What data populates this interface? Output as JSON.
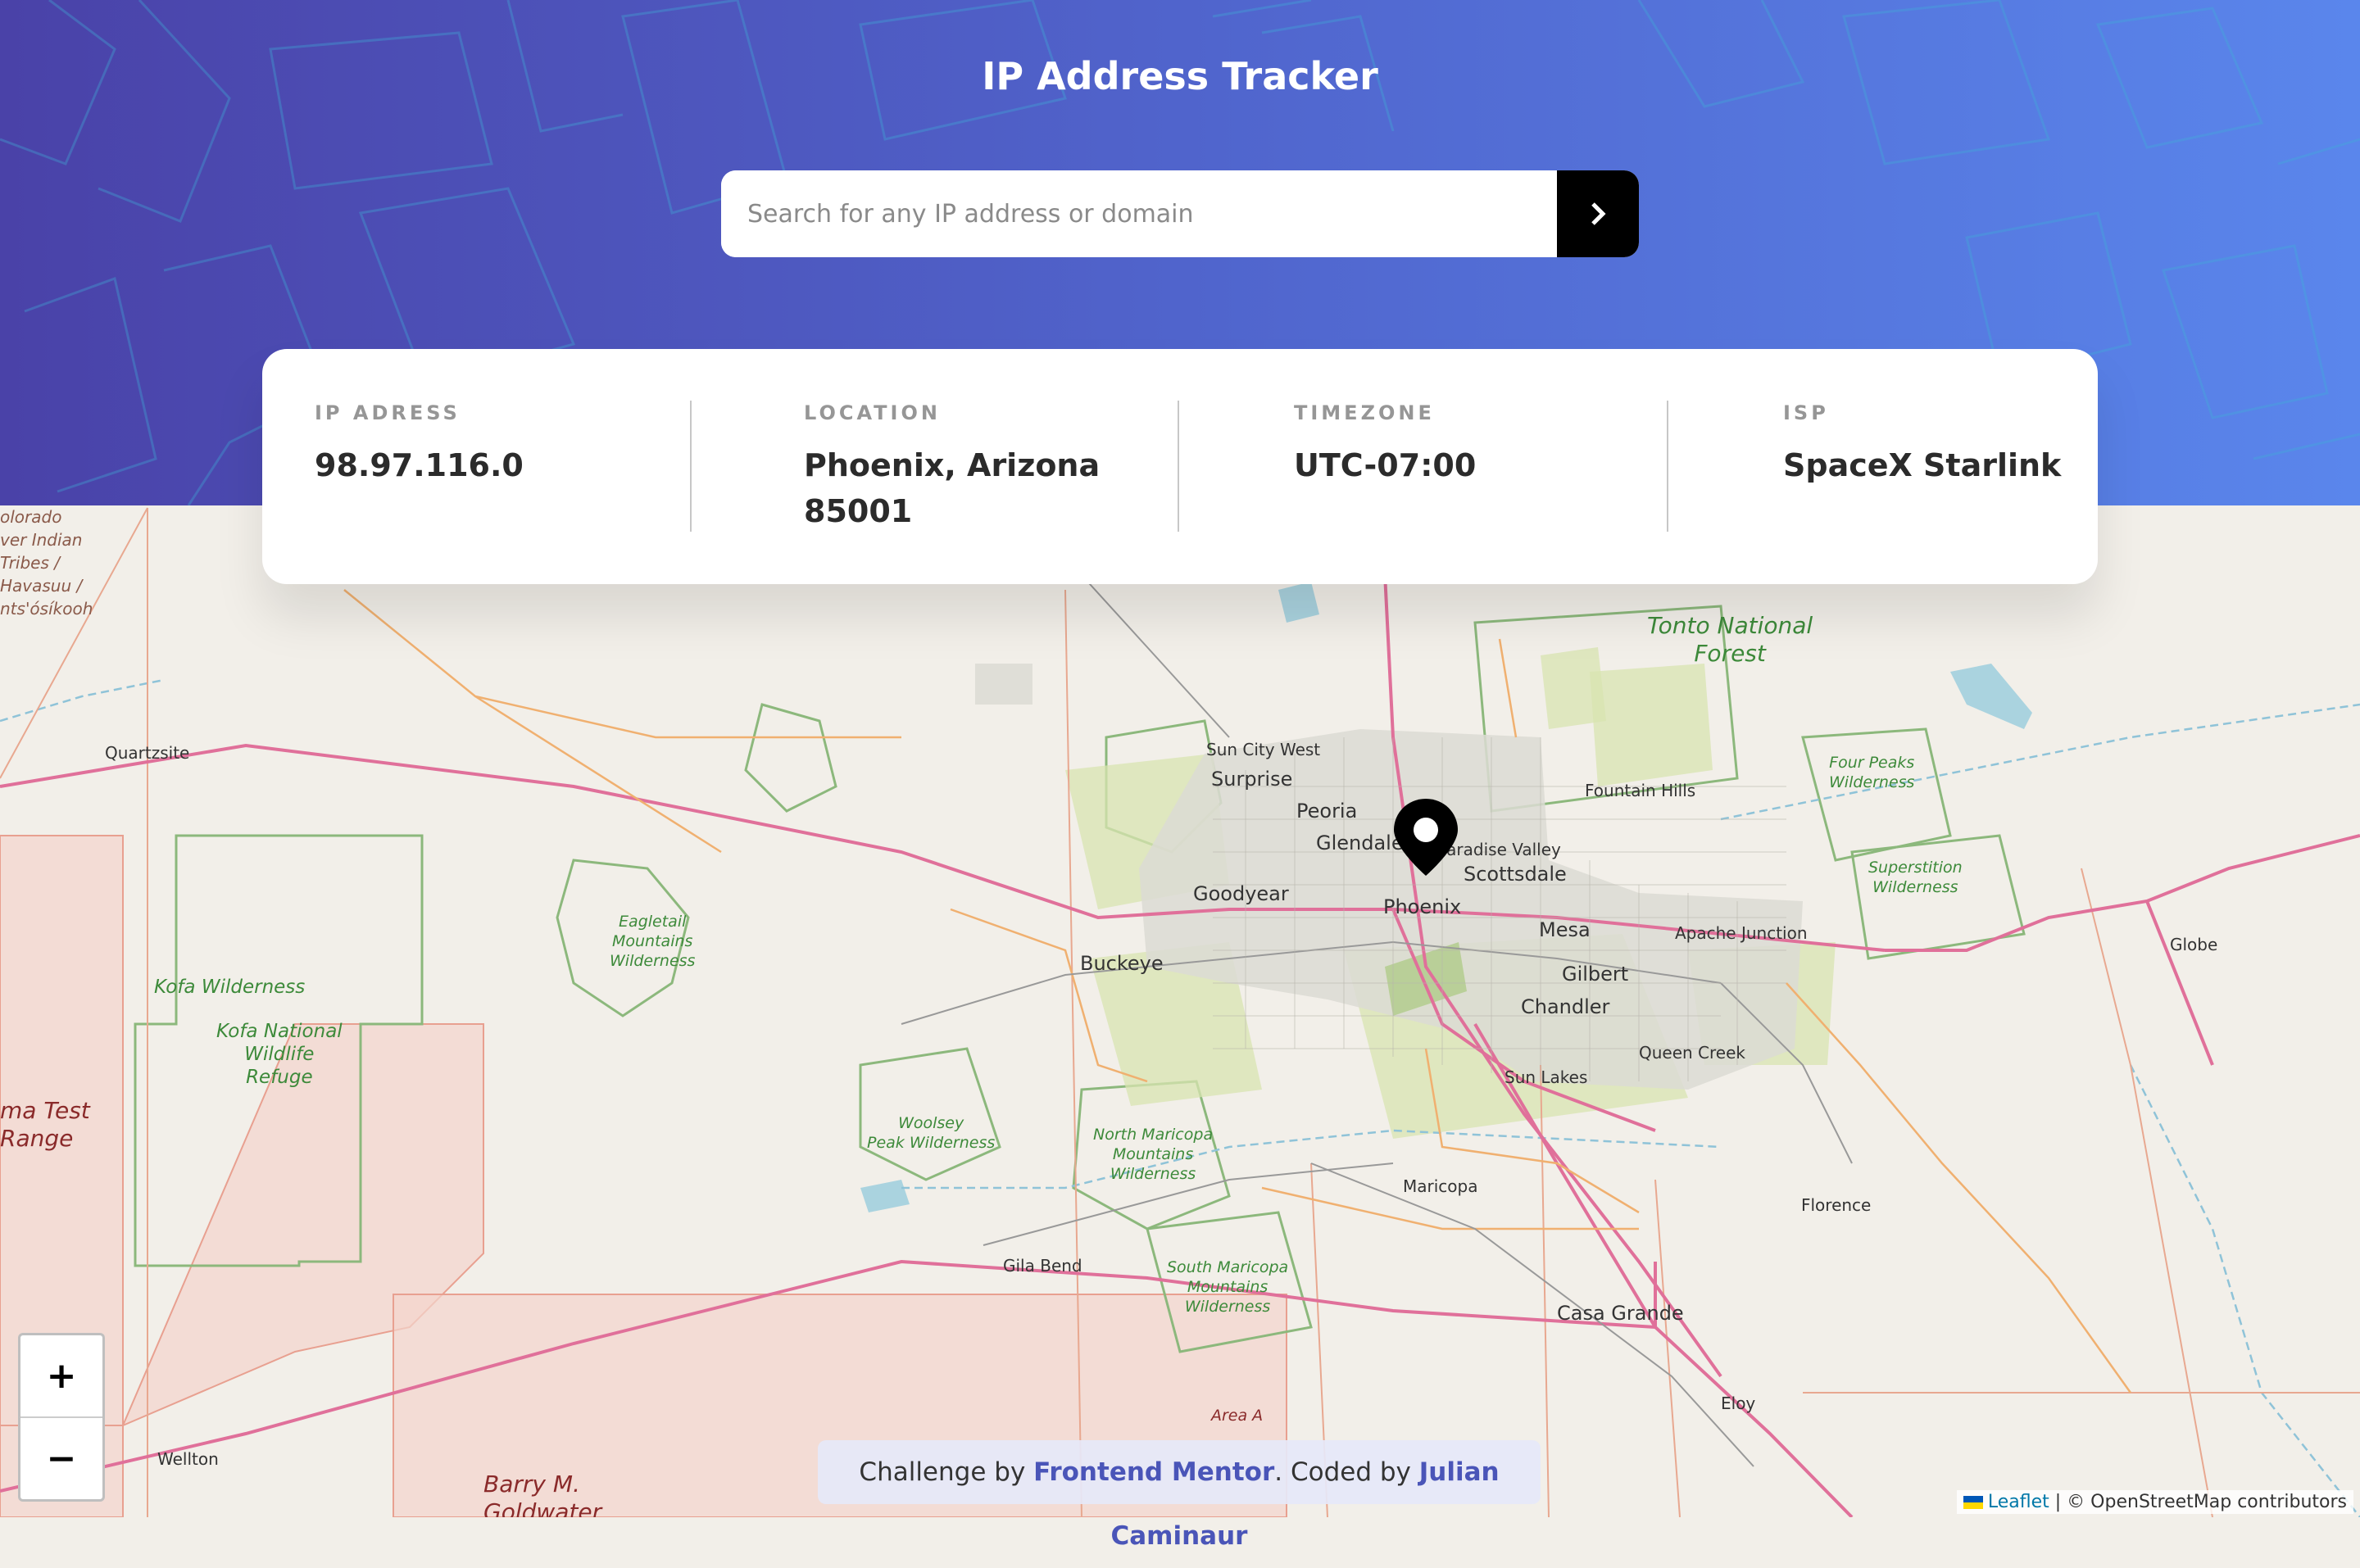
{
  "header": {
    "title": "IP Address Tracker",
    "search_placeholder": "Search for any IP address or domain",
    "search_button_icon": "chevron-right-icon",
    "gradient_colors": [
      "#4a42a8",
      "#5a86ec"
    ]
  },
  "info": {
    "ip": {
      "label": "IP Adress",
      "value": "98.97.116.0"
    },
    "location": {
      "label": "Location",
      "value_line1": "Phoenix, Arizona",
      "value_line2": "85001"
    },
    "timezone": {
      "label": "Timezone",
      "value": "UTC-07:00"
    },
    "isp": {
      "label": "ISP",
      "value": "SpaceX Starlink"
    }
  },
  "map": {
    "marker_icon": "map-pin-icon",
    "zoom_in": "+",
    "zoom_out": "−",
    "attribution_link": "Leaflet",
    "attribution_text": "| © OpenStreetMap contributors",
    "labels": {
      "phoenix": "Phoenix",
      "glendale": "Glendale",
      "peoria": "Peoria",
      "surprise": "Surprise",
      "sun_city_west": "Sun City West",
      "paradise_valley": "Paradise Valley",
      "scottsdale": "Scottsdale",
      "goodyear": "Goodyear",
      "buckeye": "Buckeye",
      "mesa": "Mesa",
      "gilbert": "Gilbert",
      "chandler": "Chandler",
      "queen_creek": "Queen Creek",
      "sun_lakes": "Sun Lakes",
      "apache_junction": "Apache Junction",
      "fountain_hills": "Fountain Hills",
      "maricopa": "Maricopa",
      "casa_grande": "Casa Grande",
      "florence": "Florence",
      "eloy": "Eloy",
      "globe": "Globe",
      "gila_bend": "Gila Bend",
      "quartzsite": "Quartzsite",
      "wellton": "Wellton",
      "tonto_forest": [
        "Tonto National",
        "Forest"
      ],
      "four_peaks": [
        "Four Peaks",
        "Wilderness"
      ],
      "superstition": [
        "Superstition",
        "Wilderness"
      ],
      "eagletail": [
        "Eagletail",
        "Mountains",
        "Wilderness"
      ],
      "kofa_wilderness": "Kofa Wilderness",
      "kofa_refuge": [
        "Kofa National",
        "Wildlife",
        "Refuge"
      ],
      "woolsey": [
        "Woolsey",
        "Peak Wilderness"
      ],
      "north_maricopa": [
        "North Maricopa",
        "Mountains",
        "Wilderness"
      ],
      "south_maricopa": [
        "South Maricopa",
        "Mountains",
        "Wilderness"
      ],
      "area_a": "Area A",
      "yuma_test": [
        "ma Test",
        "Range"
      ],
      "barry": [
        "Barry M.",
        "Goldwater"
      ],
      "colorado_tribes": [
        "olorado",
        "ver Indian",
        "Tribes /",
        "Havasuu /",
        "nts'ósíkooh"
      ]
    }
  },
  "credit": {
    "prefix": "Challenge by",
    "mentor": "Frontend Mentor",
    "middle": ". Coded by",
    "author": "Julian Caminaur"
  }
}
